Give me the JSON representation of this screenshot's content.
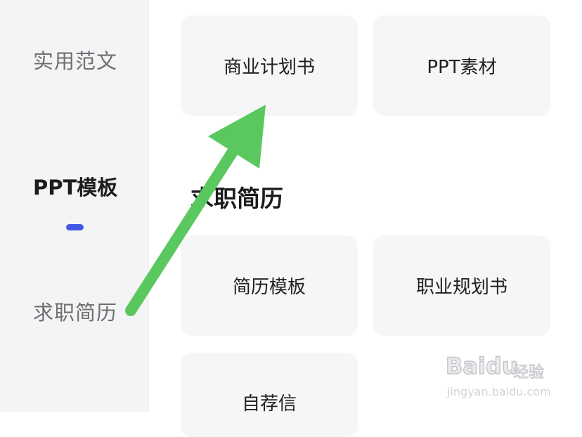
{
  "sidebar": {
    "items": [
      {
        "label": "实用范文",
        "active": false
      },
      {
        "label": "PPT模板",
        "active": true
      },
      {
        "label": "求职简历",
        "active": false
      }
    ],
    "indicator_color": "#4458e6"
  },
  "main": {
    "top_cards": [
      "商业计划书",
      "PPT素材"
    ],
    "section": {
      "title": "求职简历",
      "cards": [
        "简历模板",
        "职业规划书",
        "自荐信"
      ]
    }
  },
  "annotation": {
    "icon": "green-arrow-icon",
    "color": "#5ac85e"
  },
  "watermark": {
    "brand": "Baidu",
    "suffix": "经验",
    "url": "jingyan.baidu.com"
  }
}
